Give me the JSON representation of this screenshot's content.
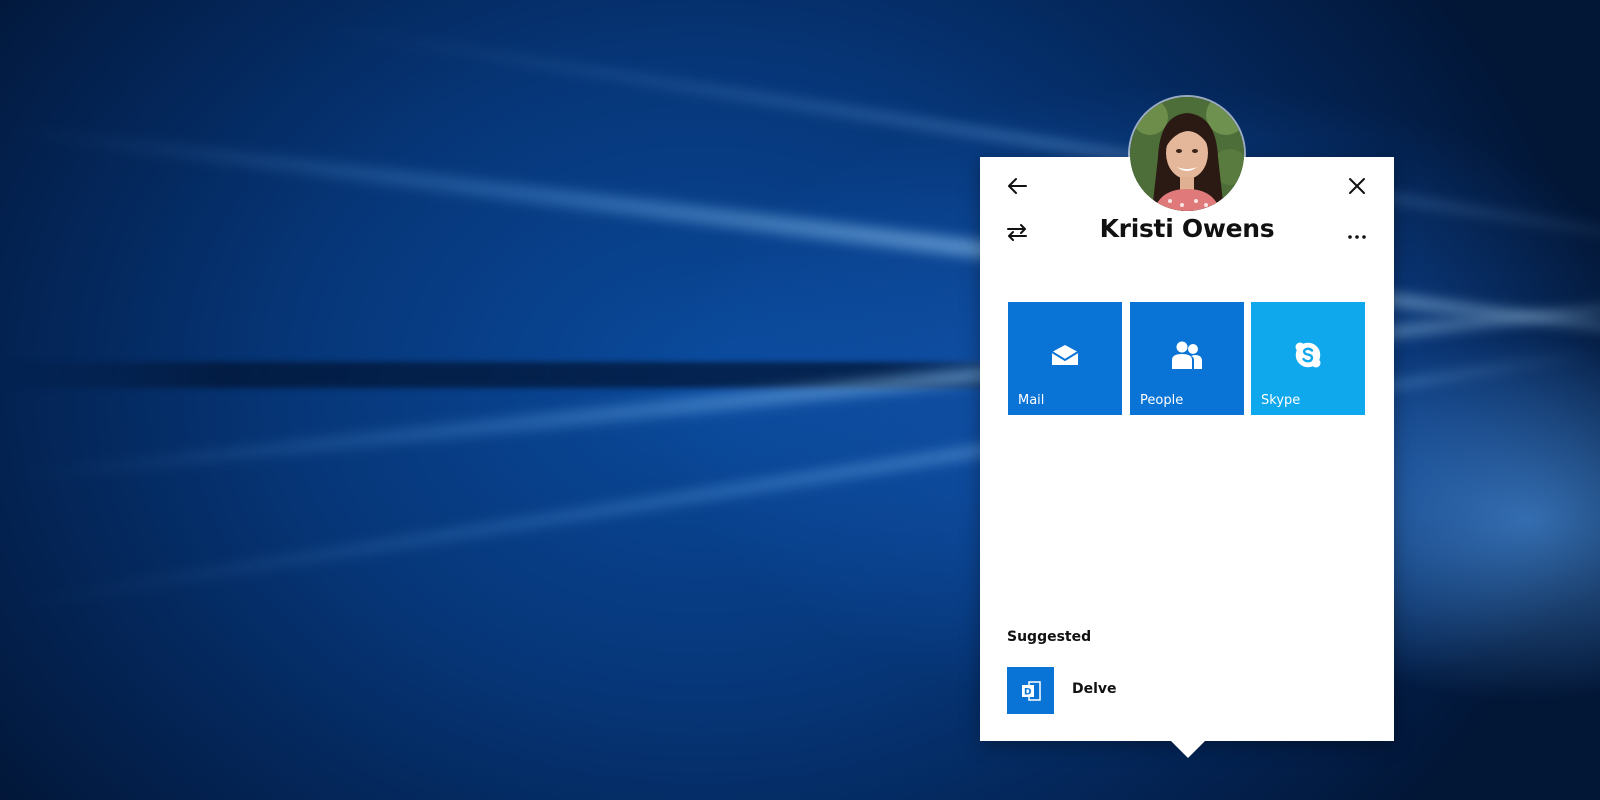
{
  "contact_card": {
    "name": "Kristi Owens",
    "back_icon": "arrow-left-icon",
    "close_icon": "close-icon",
    "switch_icon": "swap-arrows-icon",
    "more_icon": "more-ellipsis-icon",
    "avatar": "profile-photo",
    "tiles": [
      {
        "label": "Mail",
        "icon": "mail-envelope-icon",
        "color": "#0a74d6"
      },
      {
        "label": "People",
        "icon": "people-icon",
        "color": "#0a74d6"
      },
      {
        "label": "Skype",
        "icon": "skype-icon",
        "color": "#10a8ec"
      }
    ],
    "suggested": {
      "heading": "Suggested",
      "items": [
        {
          "label": "Delve",
          "icon": "delve-icon",
          "color": "#0a74d6"
        }
      ]
    }
  },
  "colors": {
    "desktop_background": "#063678",
    "card_background": "#ffffff",
    "text": "#111111"
  }
}
